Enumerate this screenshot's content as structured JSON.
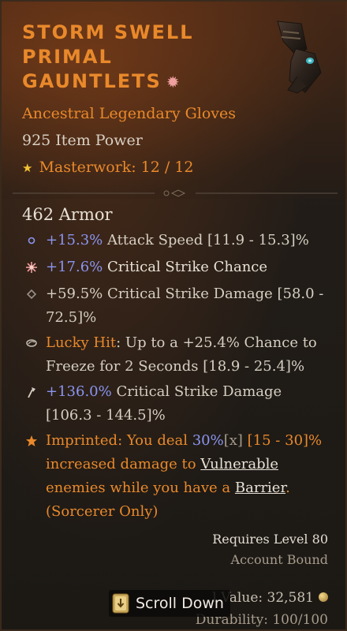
{
  "item": {
    "name_lines": [
      "STORM SWELL",
      "PRIMAL",
      "GAUNTLETS"
    ],
    "type": "Ancestral Legendary Gloves",
    "item_power": "925 Item Power",
    "masterwork_label": "Masterwork: 12 / 12",
    "armor": "462 Armor"
  },
  "affixes": [
    {
      "icon": "attack-speed-icon",
      "value": "+15.3%",
      "text": " Attack Speed [11.9 - 15.3]%"
    },
    {
      "icon": "crit-chance-icon",
      "value": "+17.6%",
      "text": " Critical Strike Chance"
    },
    {
      "icon": "crit-damage-icon",
      "line1": "+59.5% Critical Strike Damage [58.0 -",
      "line2": "72.5]%"
    },
    {
      "icon": "lucky-hit-icon",
      "prefix": "Lucky Hit",
      "line1": ": Up to a +25.4% Chance to",
      "line2": "Freeze for 2 Seconds [18.9 - 25.4]%"
    },
    {
      "icon": "tempered-icon",
      "value": "+136.0%",
      "text": " Critical Strike Damage",
      "line2": "[106.3 - 144.5]%"
    }
  ],
  "aspect": {
    "label": "Imprinted",
    "t1": ": You deal ",
    "value": "30%",
    "bracket": "[x]",
    "range": " [15 - 30]%",
    "line2_a": "increased damage to ",
    "vulnerable": "Vulnerable",
    "line3_a": "enemies while you have a ",
    "barrier": "Barrier",
    "line3_b": ".",
    "line4": "(Sorcerer Only)"
  },
  "requirements": {
    "level": "Requires Level 80",
    "bound": "Account Bound"
  },
  "footer": {
    "sell_partial": "l Value: 32,581",
    "durability_partial": "Durability: 100/100",
    "scroll_label": "Scroll Down"
  },
  "colors": {
    "legendary": "#e9892b",
    "affix_value": "#8b95f0",
    "text": "#d6cfc2"
  }
}
